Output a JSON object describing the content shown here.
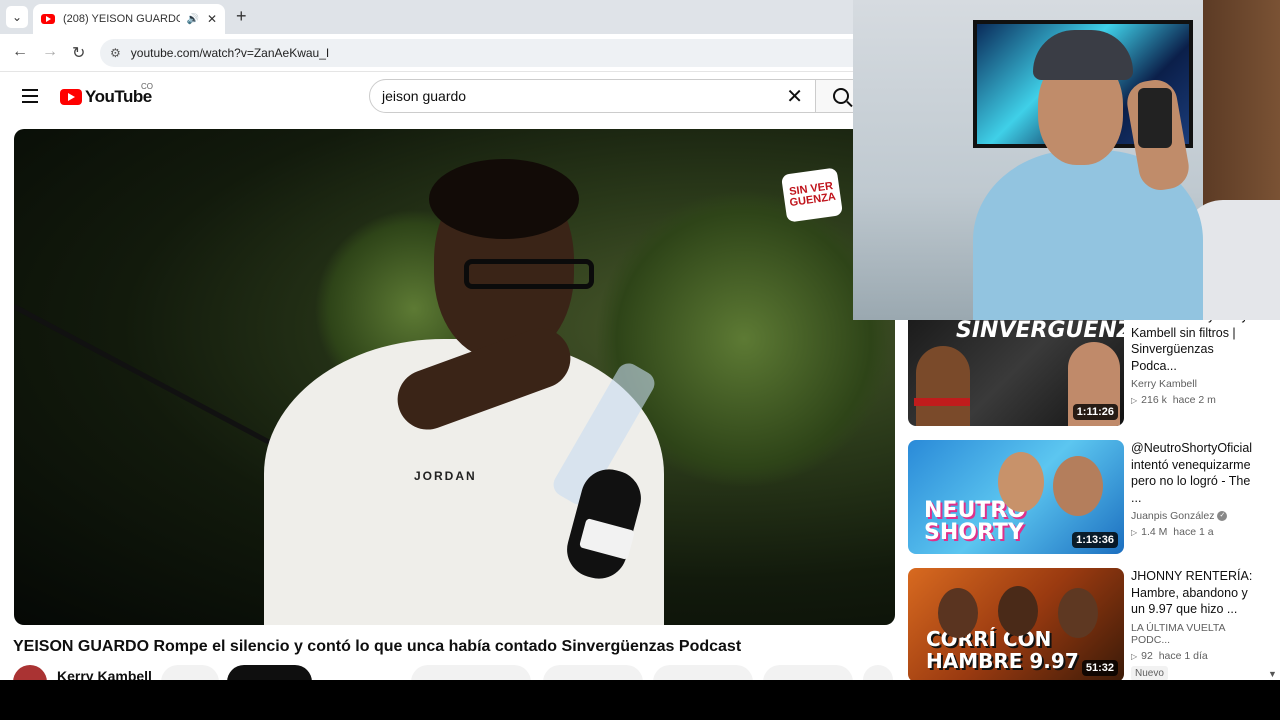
{
  "browser": {
    "tab": {
      "title": "(208) YEISON GUARDO Rompe el silencio",
      "audio_icon": "speaker-icon"
    },
    "new_tab_label": "+",
    "url": "youtube.com/watch?v=ZanAeKwau_I"
  },
  "youtube": {
    "logo_text": "YouTube",
    "country_code": "CO",
    "search": {
      "value": "jeison guardo"
    }
  },
  "video": {
    "title": "YEISON GUARDO Rompe el silencio y contó lo que unca había contado Sinvergüenzas Podcast",
    "channel": "Kerry Kambell",
    "overlay_logo": "SIN VER GUENZA",
    "shirt_text": "JORDAN"
  },
  "recommendations": [
    {
      "title": "Aida Merlano y Kerry Kambell sin filtros | Sinvergüenzas Podca...",
      "channel": "Kerry Kambell",
      "views": "216 k",
      "age": "hace 2 m",
      "duration": "1:11:26",
      "thumb_text": "SINVERGÜENZAS",
      "verified": false,
      "badge": ""
    },
    {
      "title": "@NeutroShortyOficial intentó venequizarme pero no lo logró - The ...",
      "channel": "Juanpis González",
      "views": "1.4 M",
      "age": "hace 1 a",
      "duration": "1:13:36",
      "thumb_text": "NEUTRO SHORTY",
      "verified": true,
      "badge": ""
    },
    {
      "title": "JHONNY RENTERÍA: Hambre, abandono y un 9.97 que hizo ...",
      "channel": "LA ÚLTIMA VUELTA PODC...",
      "views": "92",
      "age": "hace 1 día",
      "duration": "51:32",
      "thumb_text": "CORRÍ CON HAMBRE 9.97",
      "verified": false,
      "badge": "Nuevo"
    }
  ],
  "colors": {
    "brand": "#ff0000",
    "text": "#0f0f0f",
    "secondary": "#606060"
  }
}
